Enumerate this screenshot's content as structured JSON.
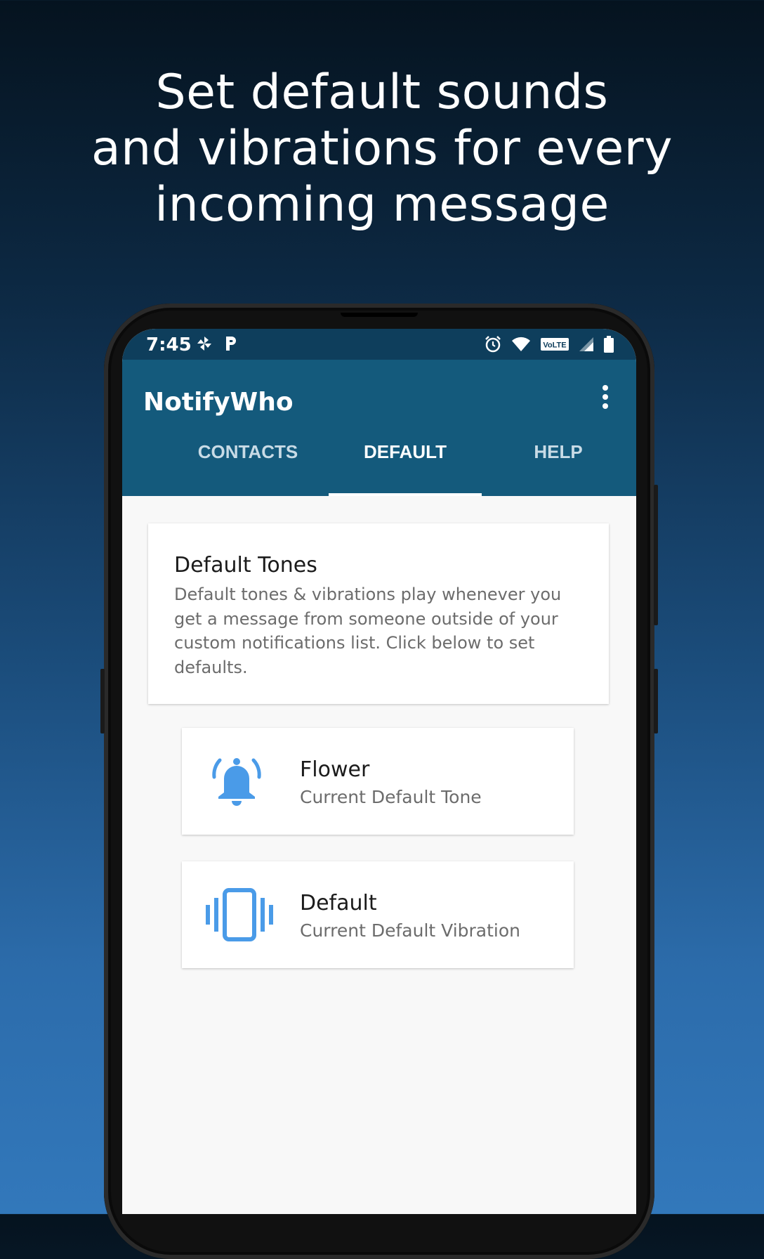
{
  "headline": {
    "line1": "Set default sounds",
    "line2": "and vibrations for every",
    "line3": "incoming message"
  },
  "status_bar": {
    "time": "7:45",
    "left_icons": [
      "pinwheel-icon",
      "parking-icon"
    ],
    "right_icons": [
      "alarm-icon",
      "wifi-icon",
      "volte-icon",
      "signal-icon",
      "battery-icon"
    ],
    "volte_label": "VoLTE"
  },
  "app_bar": {
    "title": "NotifyWho",
    "menu_icon": "more-vert-icon"
  },
  "tabs": [
    {
      "label": "CONTACTS",
      "selected": false
    },
    {
      "label": "DEFAULT",
      "selected": true
    },
    {
      "label": "HELP",
      "selected": false
    }
  ],
  "info_card": {
    "title": "Default Tones",
    "text": "Default tones & vibrations play whenever you get a message from someone outside of your custom notifications list. Click below to set defaults."
  },
  "options": [
    {
      "icon": "bell-ringing-icon",
      "title": "Flower",
      "subtitle": "Current Default Tone"
    },
    {
      "icon": "vibration-icon",
      "title": "Default",
      "subtitle": "Current Default Vibration"
    }
  ],
  "colors": {
    "app_bar": "#145a7c",
    "status_bar": "#0e3e5c",
    "accent_icon": "#4a9be8",
    "background": "#f8f8f8"
  }
}
